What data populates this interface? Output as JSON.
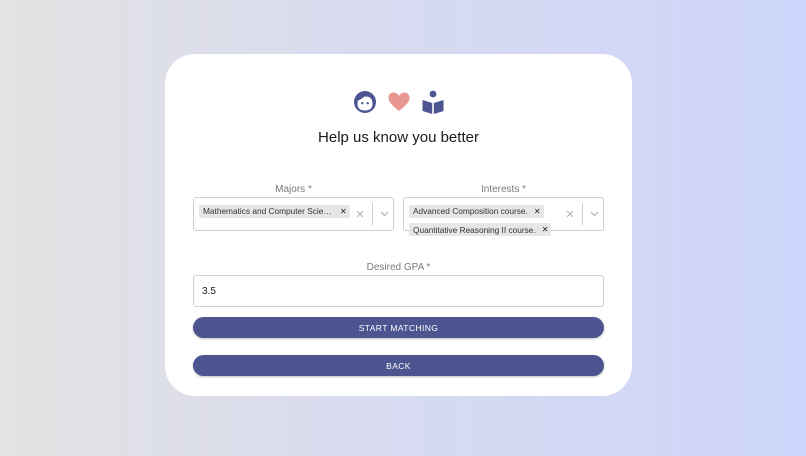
{
  "header": {
    "icons": [
      "face-icon",
      "heart-icon",
      "reading-icon"
    ],
    "title": "Help us know you better"
  },
  "form": {
    "majors": {
      "label": "Majors *",
      "selected": [
        "Mathematics and Computer Scien..."
      ]
    },
    "interests": {
      "label": "Interests *",
      "selected": [
        "Advanced Composition course.",
        "Quantitative Reasoning II course."
      ]
    },
    "gpa": {
      "label": "Desired GPA *",
      "value": "3.5"
    }
  },
  "actions": {
    "start_label": "START MATCHING",
    "back_label": "BACK"
  },
  "colors": {
    "primary": "#4d5590",
    "heart": "#e79690",
    "icon_blue": "#4d5590"
  }
}
